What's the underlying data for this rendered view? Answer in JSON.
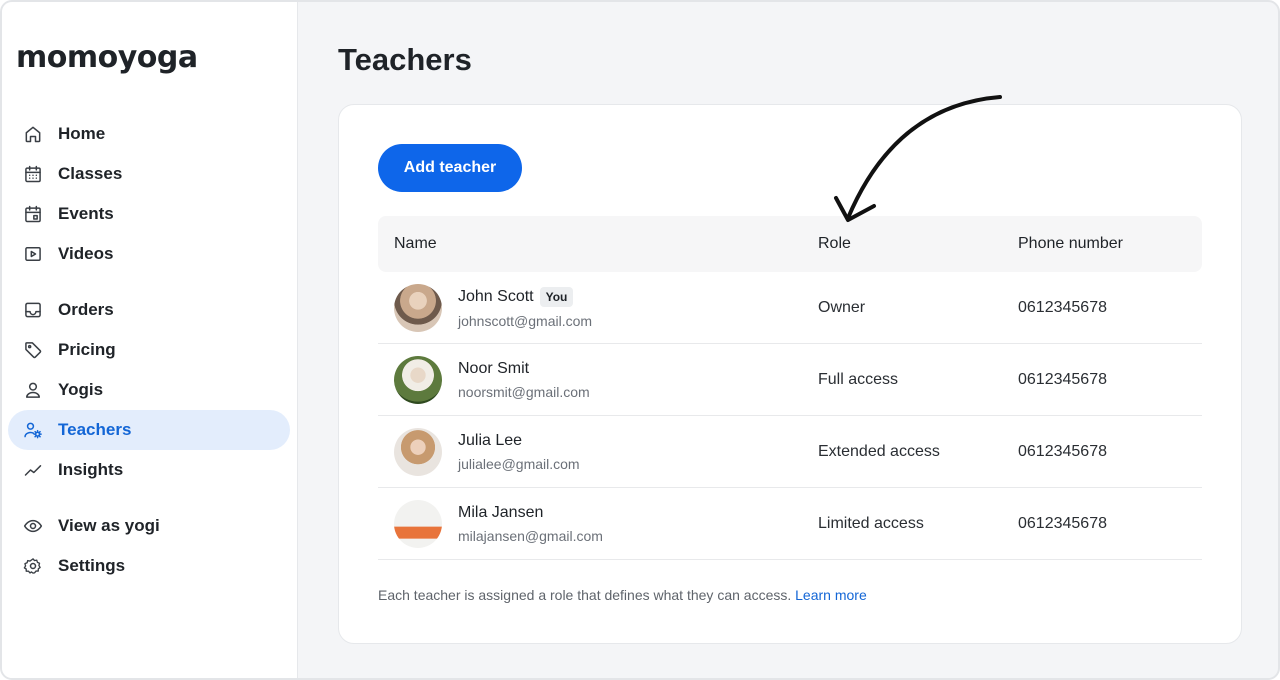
{
  "app": {
    "logo": "momoyoga"
  },
  "sidebar": {
    "items": [
      {
        "label": "Home",
        "icon": "home-icon"
      },
      {
        "label": "Classes",
        "icon": "calendar-grid-icon"
      },
      {
        "label": "Events",
        "icon": "calendar-event-icon"
      },
      {
        "label": "Videos",
        "icon": "video-icon"
      },
      {
        "label": "Orders",
        "icon": "inbox-icon"
      },
      {
        "label": "Pricing",
        "icon": "tag-icon"
      },
      {
        "label": "Yogis",
        "icon": "user-icon"
      },
      {
        "label": "Teachers",
        "icon": "user-gear-icon",
        "active": true
      },
      {
        "label": "Insights",
        "icon": "trend-icon"
      },
      {
        "label": "View as yogi",
        "icon": "eye-icon"
      },
      {
        "label": "Settings",
        "icon": "gear-icon"
      }
    ]
  },
  "main": {
    "title": "Teachers",
    "add_button": "Add teacher",
    "table": {
      "headers": {
        "name": "Name",
        "role": "Role",
        "phone": "Phone number"
      },
      "rows": [
        {
          "name": "John Scott",
          "badge": "You",
          "email": "johnscott@gmail.com",
          "role": "Owner",
          "phone": "0612345678"
        },
        {
          "name": "Noor Smit",
          "email": "noorsmit@gmail.com",
          "role": "Full access",
          "phone": "0612345678"
        },
        {
          "name": "Julia Lee",
          "email": "julialee@gmail.com",
          "role": "Extended access",
          "phone": "0612345678"
        },
        {
          "name": "Mila Jansen",
          "email": "milajansen@gmail.com",
          "role": "Limited access",
          "phone": "0612345678"
        }
      ]
    },
    "footnote": "Each teacher is assigned a role that defines what they can access.",
    "learn_more": "Learn more"
  },
  "colors": {
    "accent": "#0e66ea",
    "active_bg": "#e3edfc",
    "active_text": "#1366d6",
    "background": "#f4f5f7"
  }
}
